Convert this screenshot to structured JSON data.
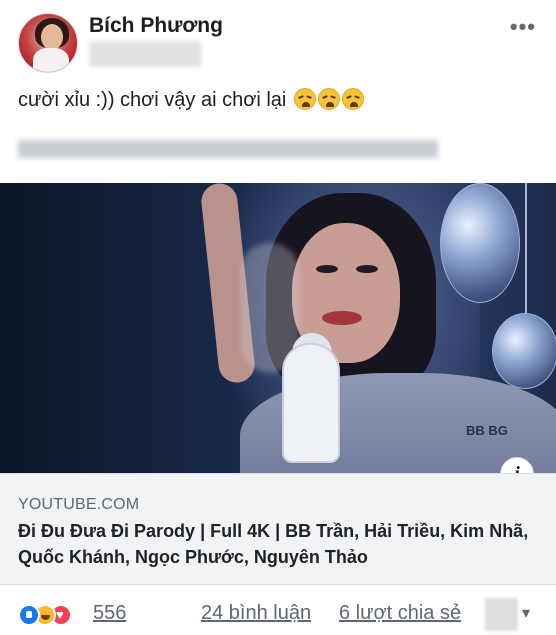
{
  "post": {
    "author": "Bích Phương",
    "status_text": "cười xỉu :)) chơi vậy ai chơi lại",
    "emoji_names": [
      "weary-face-emoji",
      "weary-face-emoji",
      "weary-face-emoji"
    ],
    "more_label": "•••"
  },
  "link": {
    "domain": "YOUTUBE.COM",
    "title": "Đi Đu Đưa Đi Parody | Full 4K | BB Trần, Hải Triều, Kim Nhã, Quốc Khánh, Ngọc Phước, Nguyên Thảo",
    "info_label": "i",
    "tattoo_text": "BB BG"
  },
  "engagement": {
    "reaction_icons": [
      "like-icon",
      "haha-icon",
      "love-icon"
    ],
    "reaction_count": "556",
    "comments": "24 bình luận",
    "shares": "6 lượt chia sẻ",
    "chevron": "▾"
  },
  "colors": {
    "accent_like": "#1877f2",
    "accent_haha": "#f7b928",
    "accent_love": "#f33e58",
    "secondary_text": "#606770"
  }
}
